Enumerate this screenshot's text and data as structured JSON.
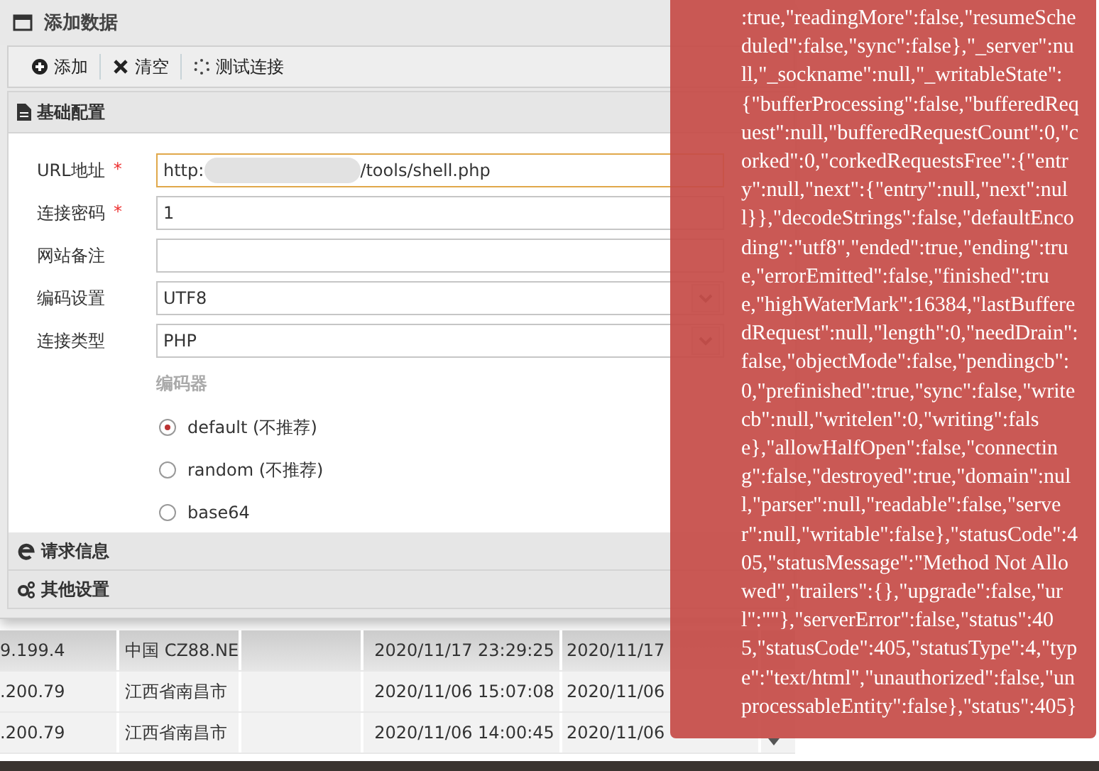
{
  "dialog": {
    "title": "添加数据"
  },
  "toolbar": [
    {
      "kind": "add",
      "label": "添加"
    },
    {
      "kind": "clear",
      "label": "清空"
    },
    {
      "kind": "test",
      "label": "测试连接"
    }
  ],
  "basic_panel": {
    "title": "基础配置",
    "fields": [
      {
        "kind": "redacted",
        "label": "URL地址",
        "required_mark": "*",
        "focused": true,
        "value_start": "http:",
        "value_end": "/tools/shell.php"
      },
      {
        "kind": "text",
        "label": "连接密码",
        "required_mark": "*",
        "focused": false,
        "value": "1"
      },
      {
        "kind": "text",
        "label": "网站备注",
        "focused": false
      },
      {
        "kind": "select",
        "label": "编码设置",
        "focused": false,
        "value": "UTF8"
      },
      {
        "kind": "select",
        "label": "连接类型",
        "focused": false,
        "value": "PHP"
      }
    ],
    "encoder": {
      "title": "编码器",
      "options": [
        {
          "label": "default (不推荐)",
          "selected": true
        },
        {
          "label": "random (不推荐)",
          "selected": false
        },
        {
          "label": "base64",
          "selected": false
        }
      ]
    }
  },
  "collapsed_panels": [
    {
      "kind": "request",
      "title": "请求信息"
    },
    {
      "kind": "other",
      "title": "其他设置"
    }
  ],
  "table": {
    "rows": [
      {
        "column_1": "9.199.4",
        "column_2": "中国 CZ88.NE",
        "column_4": "2020/11/17 23:29:25",
        "column_5": "2020/11/17",
        "selected": true
      },
      {
        "column_1": ".200.79",
        "column_2": "江西省南昌市",
        "column_4": "2020/11/06 15:07:08",
        "column_5": "2020/11/06",
        "selected": false
      },
      {
        "column_1": ".200.79",
        "column_2": "江西省南昌市",
        "column_4": "2020/11/06 14:00:45",
        "column_5": "2020/11/06",
        "selected": false
      }
    ]
  },
  "error_toast": {
    "message": ":true,\"readingMore\":false,\"resumeScheduled\":false,\"sync\":false},\"_server\":null,\"_sockname\":null,\"_writableState\":{\"bufferProcessing\":false,\"bufferedRequest\":null,\"bufferedRequestCount\":0,\"corked\":0,\"corkedRequestsFree\":{\"entry\":null,\"next\":{\"entry\":null,\"next\":null}},\"decodeStrings\":false,\"defaultEncoding\":\"utf8\",\"ended\":true,\"ending\":true,\"errorEmitted\":false,\"finished\":true,\"highWaterMark\":16384,\"lastBufferedRequest\":null,\"length\":0,\"needDrain\":false,\"objectMode\":false,\"pendingcb\":0,\"prefinished\":true,\"sync\":false,\"writecb\":null,\"writelen\":0,\"writing\":false},\"allowHalfOpen\":false,\"connecting\":false,\"destroyed\":true,\"domain\":null,\"parser\":null,\"readable\":false,\"server\":null,\"writable\":false},\"statusCode\":405,\"statusMessage\":\"Method Not Allowed\",\"trailers\":{},\"upgrade\":false,\"url\":\"\"},\"serverError\":false,\"status\":405,\"statusCode\":405,\"statusType\":4,\"type\":\"text/html\",\"unauthorized\":false,\"unprocessableEntity\":false},\"status\":405}"
  }
}
